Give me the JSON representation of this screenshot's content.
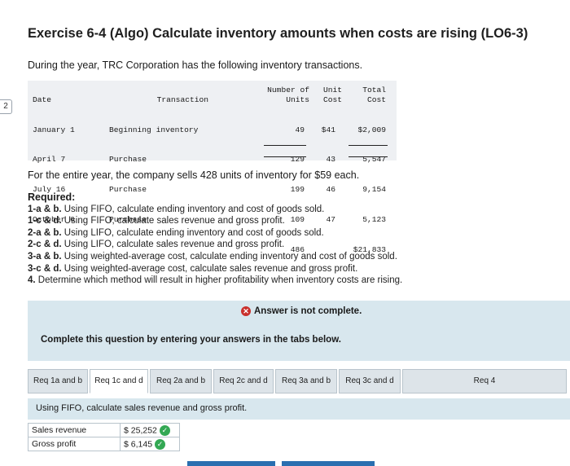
{
  "side_page_number": "2",
  "title": "Exercise 6-4 (Algo) Calculate inventory amounts when costs are rising (LO6-3)",
  "intro": "During the year, TRC Corporation has the following inventory transactions.",
  "transactions": {
    "headers": {
      "date": "Date",
      "transaction": "Transaction",
      "units_line1": "Number of",
      "units_line2": "Units",
      "unit_cost_line1": "Unit",
      "unit_cost_line2": "Cost",
      "total_cost_line1": "Total",
      "total_cost_line2": "Cost"
    },
    "rows": [
      {
        "date": "January 1",
        "transaction": "Beginning inventory",
        "units": "49",
        "unit_cost": "$41",
        "total_cost": "$2,009"
      },
      {
        "date": "April 7",
        "transaction": "Purchase",
        "units": "129",
        "unit_cost": "43",
        "total_cost": "5,547"
      },
      {
        "date": "July 16",
        "transaction": "Purchase",
        "units": "199",
        "unit_cost": "46",
        "total_cost": "9,154"
      },
      {
        "date": "October 6",
        "transaction": "Purchase",
        "units": "109",
        "unit_cost": "47",
        "total_cost": "5,123"
      }
    ],
    "total_units": "486",
    "total_cost": "$21,833"
  },
  "sells_text": "For the entire year, the company sells 428 units of inventory for $59 each.",
  "required": {
    "title": "Required:",
    "items": [
      {
        "num": "1-a & b.",
        "text": "Using FIFO, calculate ending inventory and cost of goods sold."
      },
      {
        "num": "1-c & d.",
        "text": "Using FIFO, calculate sales revenue and gross profit."
      },
      {
        "num": "2-a & b.",
        "text": "Using LIFO, calculate ending inventory and cost of goods sold."
      },
      {
        "num": "2-c & d.",
        "text": "Using LIFO, calculate sales revenue and gross profit."
      },
      {
        "num": "3-a & b.",
        "text": "Using weighted-average cost, calculate ending inventory and cost of goods sold."
      },
      {
        "num": "3-c & d.",
        "text": "Using weighted-average cost, calculate sales revenue and gross profit."
      },
      {
        "num": "4.",
        "text": "Determine which method will result in higher profitability when inventory costs are rising."
      }
    ]
  },
  "answer_status": "Answer is not complete.",
  "complete_prompt": "Complete this question by entering your answers in the tabs below.",
  "tabs": [
    {
      "label": "Req 1a and b",
      "active": false
    },
    {
      "label": "Req 1c and d",
      "active": true
    },
    {
      "label": "Req 2a and b",
      "active": false
    },
    {
      "label": "Req 2c and d",
      "active": false
    },
    {
      "label": "Req 3a and b",
      "active": false
    },
    {
      "label": "Req 3c and d",
      "active": false
    },
    {
      "label": "Req 4",
      "active": false
    }
  ],
  "panel_instruction": "Using FIFO, calculate sales revenue and gross profit.",
  "answers": [
    {
      "label": "Sales revenue",
      "currency": "$",
      "value": "25,252",
      "status": "correct"
    },
    {
      "label": "Gross profit",
      "currency": "$",
      "value": "6,145",
      "status": "correct"
    }
  ],
  "colors": {
    "accent_band": "#d8e7ee",
    "error": "#c9302c",
    "correct": "#33a853",
    "nav_bar": "#2a6fb0"
  }
}
